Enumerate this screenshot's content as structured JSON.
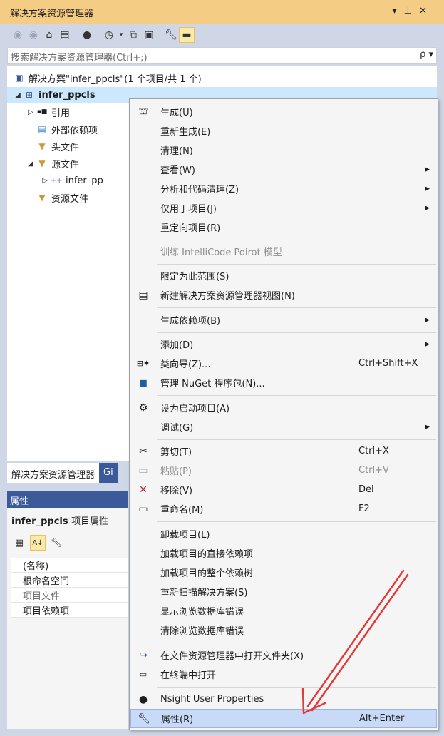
{
  "window": {
    "title": "解决方案资源管理器",
    "controls": [
      "▾",
      "⊥",
      "✕"
    ]
  },
  "toolbar": {
    "icons": [
      "back-icon",
      "forward-icon",
      "home-icon",
      "switch-views-icon",
      "globe-icon",
      "pending-changes-icon",
      "collapse-all-icon",
      "show-all-files-icon",
      "properties-icon",
      "preview-icon"
    ]
  },
  "search": {
    "placeholder": "搜索解决方案资源管理器(Ctrl+;)",
    "icon_label": "ρ ▾"
  },
  "tree": {
    "solution": "解决方案\"infer_ppcls\"(1 个项目/共 1 个)",
    "project": "infer_ppcls",
    "items": [
      {
        "label": "引用",
        "arrow": "▷",
        "indent": 2
      },
      {
        "label": "外部依赖项",
        "arrow": "",
        "indent": 2
      },
      {
        "label": "头文件",
        "arrow": "",
        "indent": 2
      },
      {
        "label": "源文件",
        "arrow": "◢",
        "indent": 2
      },
      {
        "label": "infer_pp",
        "arrow": "▷",
        "indent": 3
      },
      {
        "label": "资源文件",
        "arrow": "",
        "indent": 2
      }
    ]
  },
  "bottom_tabs": {
    "active": "解决方案资源管理器",
    "other": "Gi"
  },
  "properties": {
    "header": "属性",
    "title": "infer_ppcls",
    "title_suffix": "项目属性",
    "rows": [
      {
        "name": "(名称)",
        "dim": false
      },
      {
        "name": "根命名空间",
        "dim": false
      },
      {
        "name": "项目文件",
        "dim": true
      },
      {
        "name": "项目依赖项",
        "dim": false
      }
    ]
  },
  "context_menu": {
    "items": [
      {
        "label": "生成(U)",
        "icon": "build-icon",
        "key": "",
        "arrow": false
      },
      {
        "label": "重新生成(E)",
        "icon": "",
        "key": "",
        "arrow": false
      },
      {
        "label": "清理(N)",
        "icon": "",
        "key": "",
        "arrow": false
      },
      {
        "label": "查看(W)",
        "icon": "",
        "key": "",
        "arrow": true
      },
      {
        "label": "分析和代码清理(Z)",
        "icon": "",
        "key": "",
        "arrow": true
      },
      {
        "label": "仅用于项目(J)",
        "icon": "",
        "key": "",
        "arrow": true
      },
      {
        "label": "重定向项目(R)",
        "icon": "",
        "key": "",
        "arrow": false
      },
      {
        "label": "训练 IntelliCode Poirot 模型",
        "icon": "",
        "key": "",
        "arrow": false,
        "disabled": true
      },
      {
        "label": "限定为此范围(S)",
        "icon": "",
        "key": "",
        "arrow": false
      },
      {
        "label": "新建解决方案资源管理器视图(N)",
        "icon": "new-view-icon",
        "key": "",
        "arrow": false
      },
      {
        "label": "生成依赖项(B)",
        "icon": "",
        "key": "",
        "arrow": true
      },
      {
        "label": "添加(D)",
        "icon": "",
        "key": "",
        "arrow": true
      },
      {
        "label": "类向导(Z)...",
        "icon": "class-wizard-icon",
        "key": "Ctrl+Shift+X",
        "arrow": false
      },
      {
        "label": "管理 NuGet 程序包(N)...",
        "icon": "nuget-icon",
        "key": "",
        "arrow": false
      },
      {
        "label": "设为启动项目(A)",
        "icon": "gear-icon",
        "key": "",
        "arrow": false
      },
      {
        "label": "调试(G)",
        "icon": "",
        "key": "",
        "arrow": true
      },
      {
        "label": "剪切(T)",
        "icon": "scissors-icon",
        "key": "Ctrl+X",
        "arrow": false
      },
      {
        "label": "粘贴(P)",
        "icon": "paste-icon",
        "key": "Ctrl+V",
        "arrow": false,
        "disabled": true
      },
      {
        "label": "移除(V)",
        "icon": "remove-icon",
        "key": "Del",
        "arrow": false
      },
      {
        "label": "重命名(M)",
        "icon": "rename-icon",
        "key": "F2",
        "arrow": false
      },
      {
        "label": "卸载项目(L)",
        "icon": "",
        "key": "",
        "arrow": false
      },
      {
        "label": "加载项目的直接依赖项",
        "icon": "",
        "key": "",
        "arrow": false
      },
      {
        "label": "加载项目的整个依赖树",
        "icon": "",
        "key": "",
        "arrow": false
      },
      {
        "label": "重新扫描解决方案(S)",
        "icon": "",
        "key": "",
        "arrow": false
      },
      {
        "label": "显示浏览数据库错误",
        "icon": "",
        "key": "",
        "arrow": false
      },
      {
        "label": "清除浏览数据库错误",
        "icon": "",
        "key": "",
        "arrow": false
      },
      {
        "label": "在文件资源管理器中打开文件夹(X)",
        "icon": "open-folder-icon",
        "key": "",
        "arrow": false
      },
      {
        "label": "在终端中打开",
        "icon": "terminal-icon",
        "key": "",
        "arrow": false
      },
      {
        "label": "Nsight User Properties",
        "icon": "nsight-icon",
        "key": "",
        "arrow": false
      },
      {
        "label": "属性(R)",
        "icon": "wrench-icon",
        "key": "Alt+Enter",
        "arrow": false,
        "highlighted": true
      }
    ]
  },
  "colors": {
    "title_bg": "#f5cc84",
    "highlight_bg": "#c9daf8",
    "annotation_arrow": "#e53935"
  }
}
